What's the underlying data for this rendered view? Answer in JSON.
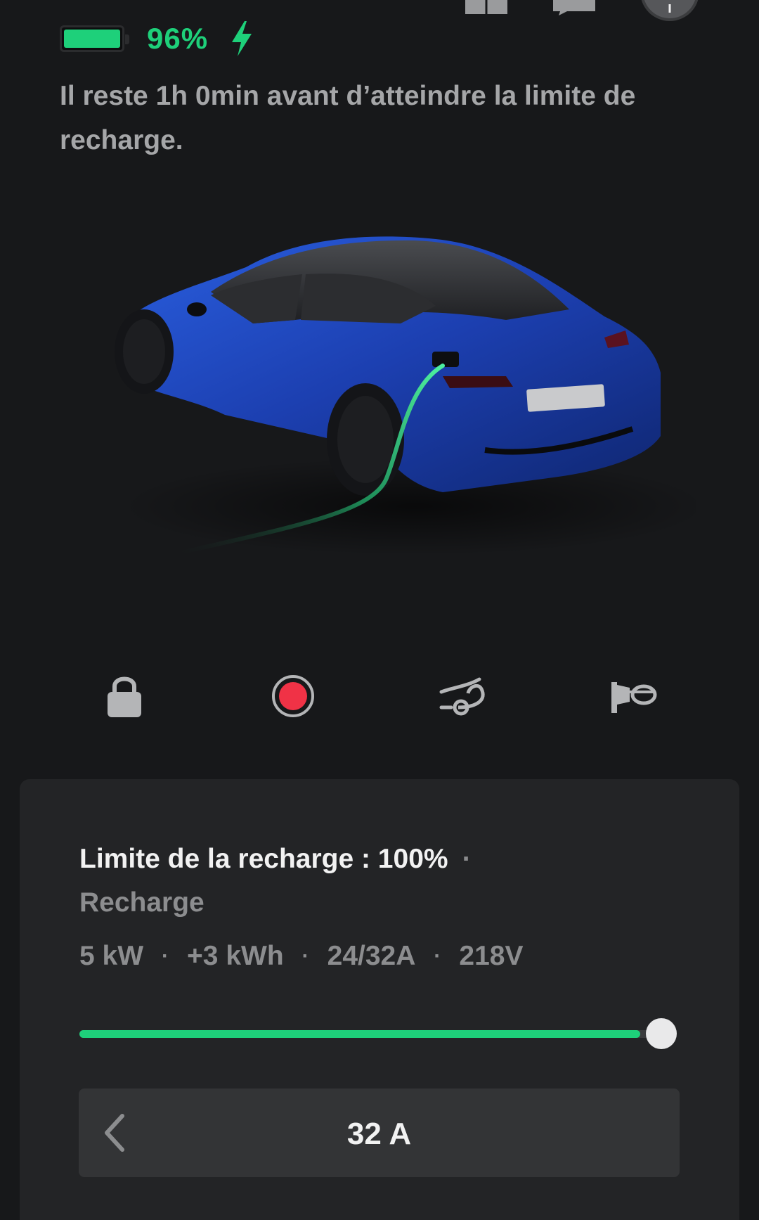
{
  "status": {
    "battery_percent_value": 0.96,
    "battery_percent_text": "96%",
    "charging": true,
    "accent_color": "#1ed07a"
  },
  "message": {
    "remaining_text": "Il reste 1h 0min avant d’atteindre la limite de recharge."
  },
  "top_icons": [
    "model-icon",
    "chat-icon",
    "profile-avatar"
  ],
  "actions": [
    {
      "name": "lock-button",
      "icon": "lock-icon"
    },
    {
      "name": "sentry-button",
      "icon": "record-icon"
    },
    {
      "name": "frunk-button",
      "icon": "frunk-icon"
    },
    {
      "name": "horn-button",
      "icon": "horn-icon"
    }
  ],
  "charge": {
    "limit_text": "Limite de la recharge : 100%",
    "separator": "·",
    "state": "Recharge",
    "stats": [
      "5 kW",
      "+3 kWh",
      "24/32A",
      "218V"
    ],
    "limit_value": 1.0,
    "amps_text": "32 A"
  },
  "colors": {
    "background": "#17181a",
    "card": "#232426",
    "car_body": "#1f47c0"
  }
}
